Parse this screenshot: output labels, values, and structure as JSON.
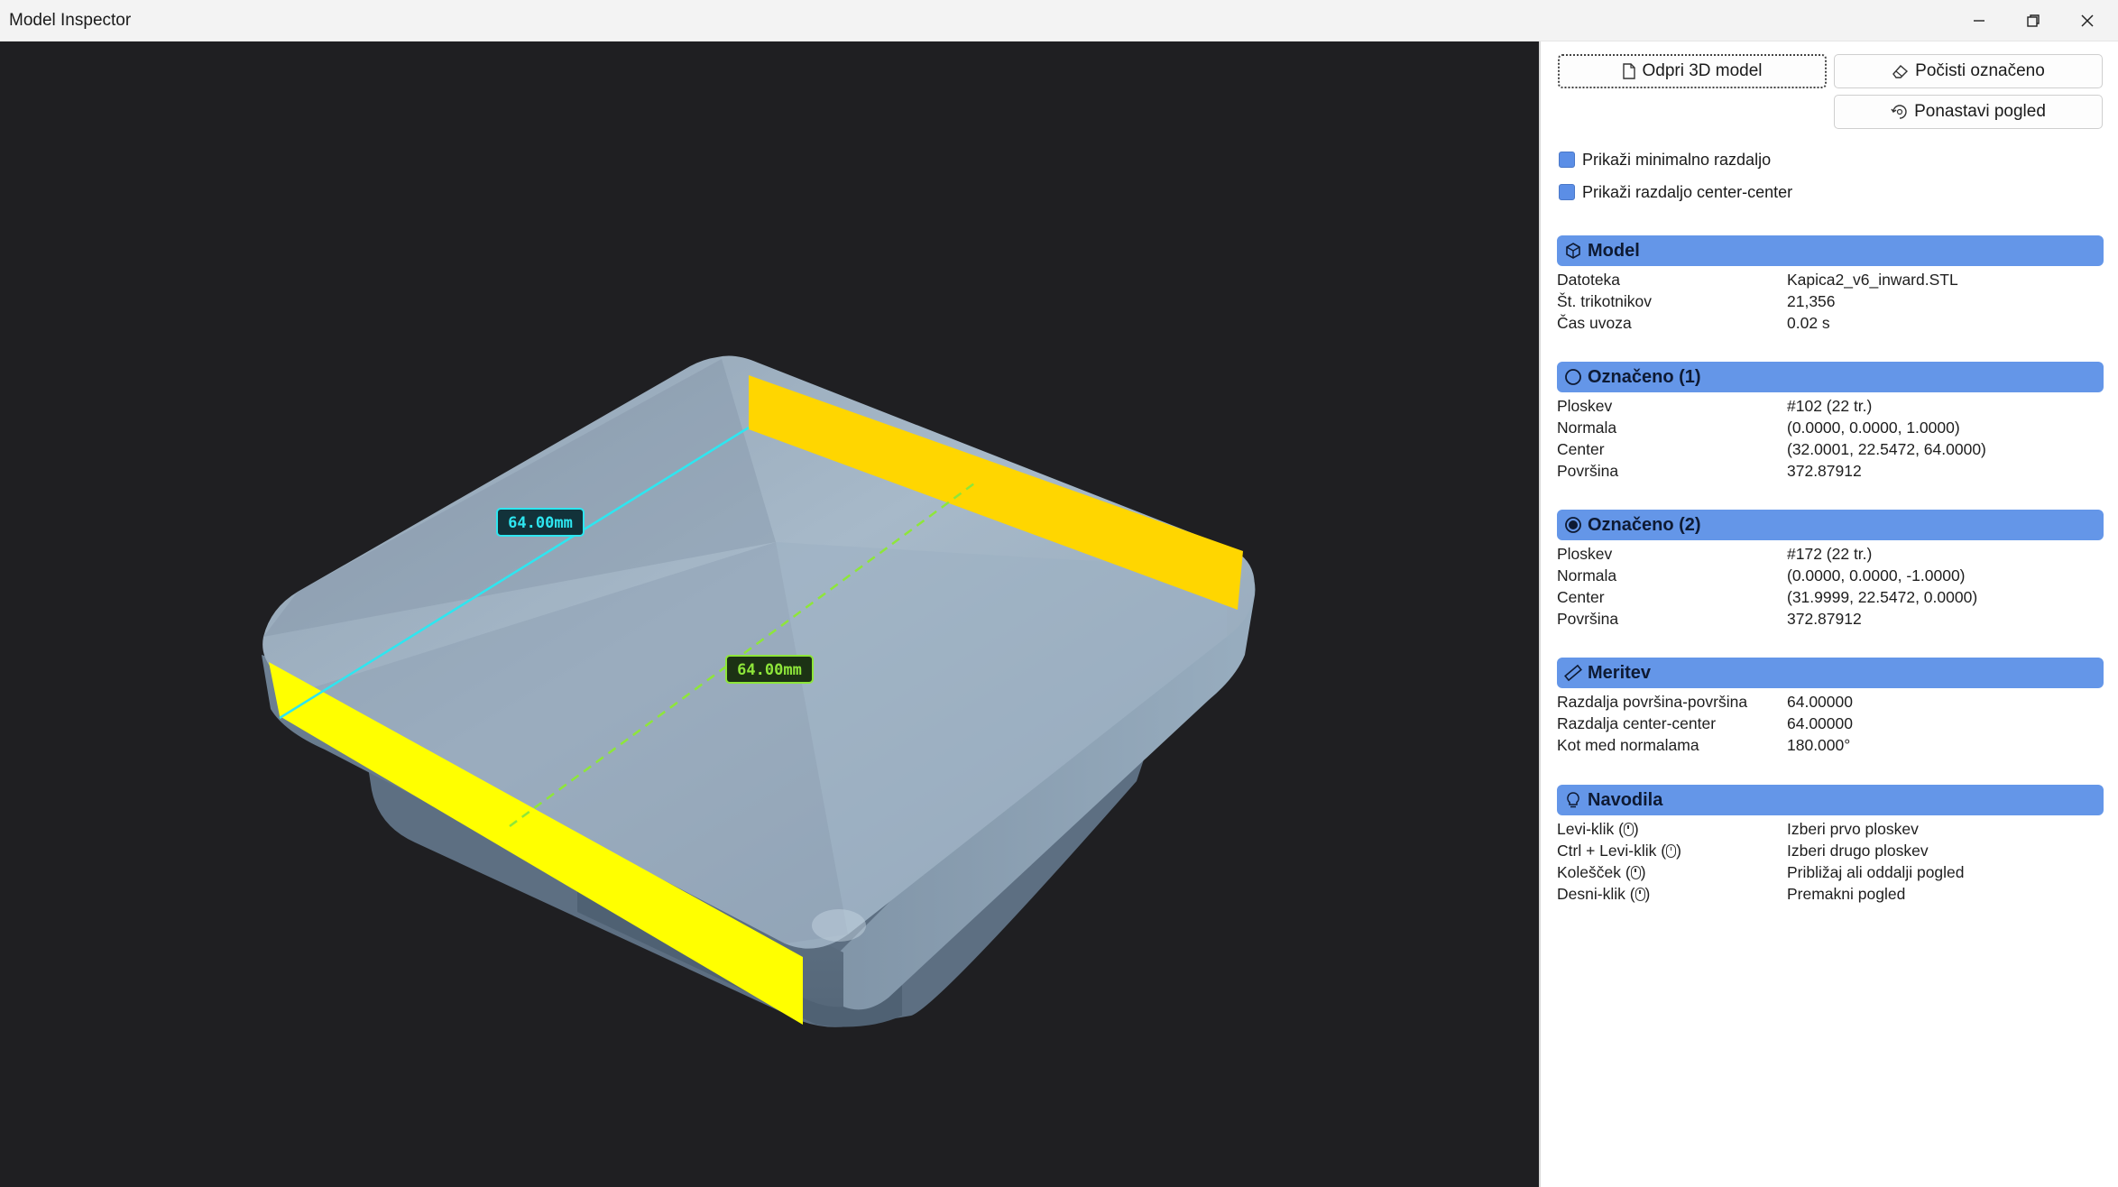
{
  "window": {
    "title": "Model Inspector"
  },
  "viewport": {
    "measure_surface_label": "64.00mm",
    "measure_center_label": "64.00mm",
    "colors": {
      "background": "#1f1f22",
      "model": "#9fb3c4",
      "face_selected": "#ffff00",
      "face_selected_2": "#ffd600",
      "surface_line": "#2ee6f0",
      "center_line": "#8ee63a"
    }
  },
  "toolbar": {
    "open_label": "Odpri 3D model",
    "clear_label": "Počisti označeno",
    "reset_label": "Ponastavi pogled"
  },
  "options": {
    "min_distance_label": "Prikaži minimalno razdaljo",
    "center_distance_label": "Prikaži razdaljo center-center"
  },
  "model": {
    "header": "Model",
    "rows": [
      {
        "key": "Datoteka",
        "value": "Kapica2_v6_inward.STL"
      },
      {
        "key": "Št. trikotnikov",
        "value": "21,356"
      },
      {
        "key": "Čas uvoza",
        "value": "0.02 s"
      }
    ]
  },
  "selected1": {
    "header": "Označeno (1)",
    "rows": [
      {
        "key": "Ploskev",
        "value": "#102 (22 tr.)"
      },
      {
        "key": "Normala",
        "value": "(0.0000, 0.0000, 1.0000)"
      },
      {
        "key": "Center",
        "value": "(32.0001, 22.5472, 64.0000)"
      },
      {
        "key": "Površina",
        "value": "372.87912"
      }
    ]
  },
  "selected2": {
    "header": "Označeno (2)",
    "rows": [
      {
        "key": "Ploskev",
        "value": "#172 (22 tr.)"
      },
      {
        "key": "Normala",
        "value": "(0.0000, 0.0000, -1.0000)"
      },
      {
        "key": "Center",
        "value": "(31.9999, 22.5472, 0.0000)"
      },
      {
        "key": "Površina",
        "value": "372.87912"
      }
    ]
  },
  "measure": {
    "header": "Meritev",
    "rows": [
      {
        "key": "Razdalja površina-površina",
        "value": "64.00000"
      },
      {
        "key": "Razdalja center-center",
        "value": "64.00000"
      },
      {
        "key": "Kot med normalama",
        "value": "180.000°"
      }
    ]
  },
  "help": {
    "header": "Navodila",
    "rows": [
      {
        "key": "Levi-klik (",
        "value": "Izberi prvo ploskev"
      },
      {
        "key": "Ctrl + Levi-klik (",
        "value": "Izberi drugo ploskev"
      },
      {
        "key": "Kolešček (",
        "value": "Približaj ali oddalji pogled"
      },
      {
        "key": "Desni-klik (",
        "value": "Premakni pogled"
      }
    ],
    "suffix": ")"
  }
}
